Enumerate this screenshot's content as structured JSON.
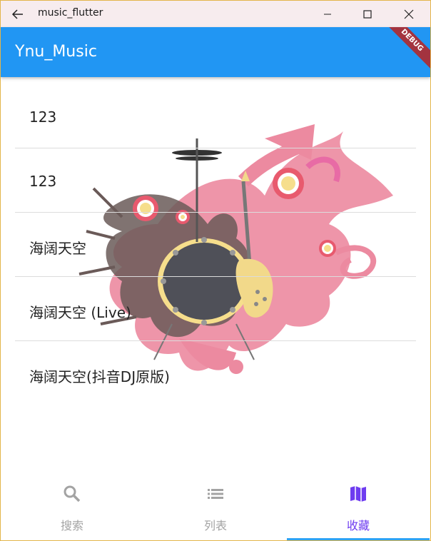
{
  "window": {
    "title": "music_flutter"
  },
  "appbar": {
    "title": "Ynu_Music",
    "debug_banner": "DEBUG",
    "color": "#2196f3"
  },
  "list": {
    "items": [
      {
        "label": "123"
      },
      {
        "label": "123"
      },
      {
        "label": "海阔天空"
      },
      {
        "label": "海阔天空 (Live)"
      },
      {
        "label": "海阔天空(抖音DJ原版)"
      }
    ]
  },
  "bottom_nav": {
    "items": [
      {
        "label": "搜索",
        "icon": "search-icon"
      },
      {
        "label": "列表",
        "icon": "list-icon"
      },
      {
        "label": "收藏",
        "icon": "map-icon"
      }
    ],
    "selected_index": 2,
    "active_color": "#6e3cf0",
    "inactive_color": "#a3a3a3"
  }
}
